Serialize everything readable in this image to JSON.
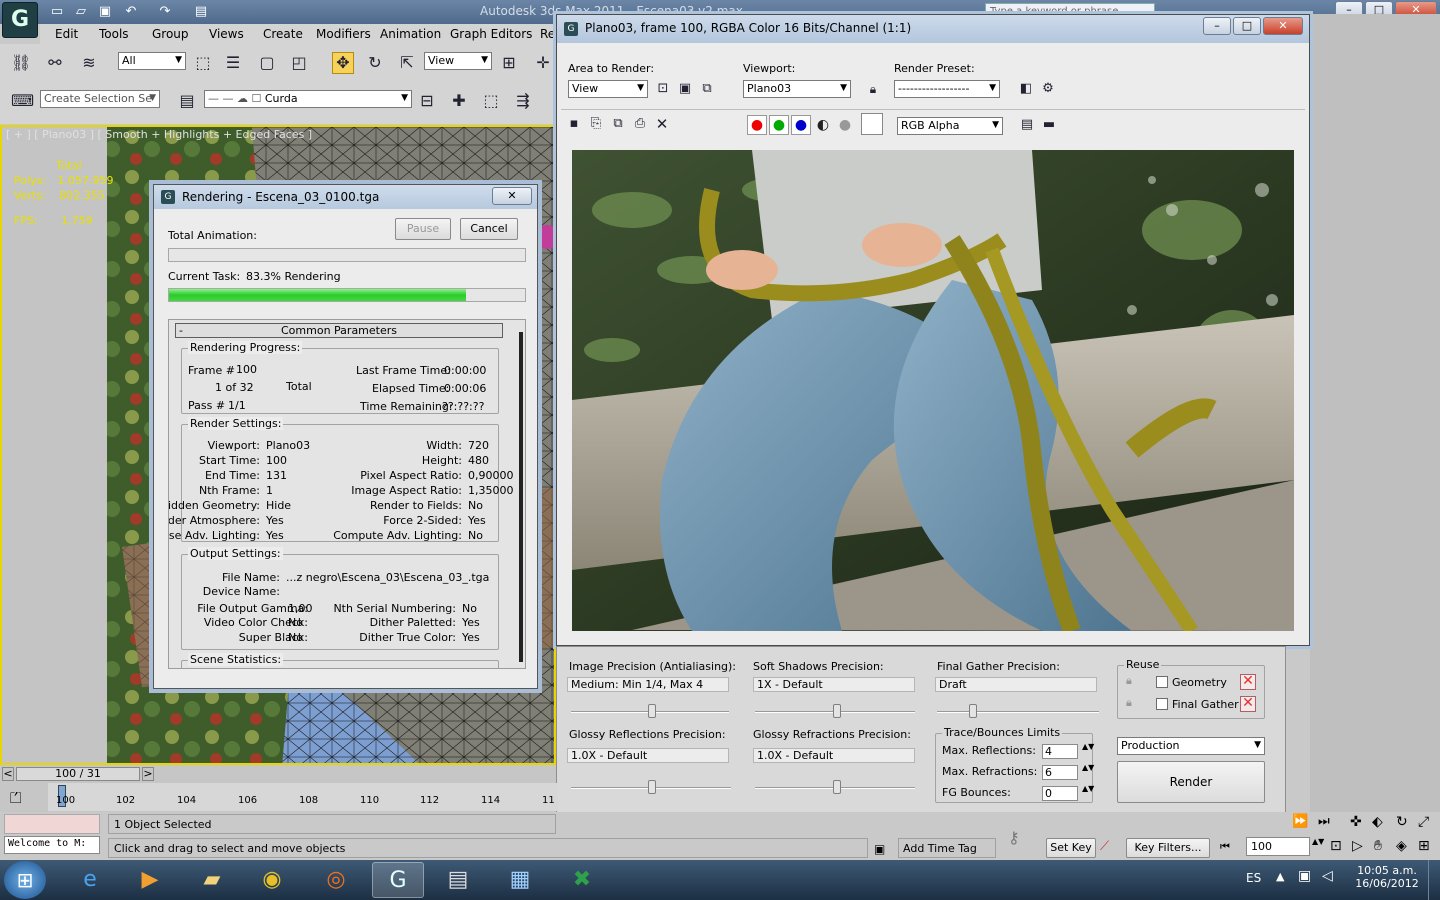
{
  "app": {
    "title": "Autodesk 3ds Max 2011 - Escena03 v2.max",
    "menu": [
      "Edit",
      "Tools",
      "Group",
      "Views",
      "Create",
      "Modifiers",
      "Animation",
      "Graph Editors",
      "Re"
    ],
    "search_placeholder": "Type a keyword or phrase",
    "selection_filter": "All",
    "ref_coord": "View",
    "named_selection": "Create Selection Se",
    "layer": "Curda"
  },
  "viewport": {
    "label": "[ + ] [ Plano03 ] [ Smooth + Highlights + Edged Faces ]",
    "stats_total": "Total",
    "polys_label": "Polys:",
    "polys_value": "1.057.959",
    "verts_label": "Verts:",
    "verts_value": "802.355",
    "fps_label": "FPS:",
    "fps_value": "1,759"
  },
  "rendering_dialog": {
    "title": "Rendering - Escena_03_0100.tga",
    "pause": "Pause",
    "cancel": "Cancel",
    "total_animation_label": "Total Animation:",
    "total_animation_progress": 0.0,
    "current_task_label": "Current Task:",
    "current_task_value": "83.3%  Rendering",
    "current_task_progress": 0.833,
    "rollout_title": "Common Parameters",
    "rollout_toggle": "-",
    "progress_group": "Rendering Progress:",
    "frame_label": "Frame #",
    "frame_value": "100",
    "of_value": "1 of 32",
    "total_label": "Total",
    "pass_label": "Pass #",
    "pass_value": "1/1",
    "last_frame_time_label": "Last Frame Time:",
    "last_frame_time": "0:00:00",
    "elapsed_label": "Elapsed Time:",
    "elapsed": "0:00:06",
    "remaining_label": "Time Remaining:",
    "remaining": "??:??:??",
    "render_settings_group": "Render Settings:",
    "viewport_label": "Viewport:",
    "viewport_value": "Plano03",
    "width_label": "Width:",
    "width_value": "720",
    "start_label": "Start Time:",
    "start_value": "100",
    "height_label": "Height:",
    "height_value": "480",
    "end_label": "End Time:",
    "end_value": "131",
    "pixel_aspect_label": "Pixel Aspect Ratio:",
    "pixel_aspect_value": "0,90000",
    "nth_label": "Nth Frame:",
    "nth_value": "1",
    "image_aspect_label": "Image Aspect Ratio:",
    "image_aspect_value": "1,35000",
    "hidden_geo_label": "Hidden Geometry:",
    "hidden_geo_value": "Hide",
    "render_fields_label": "Render to Fields:",
    "render_fields_value": "No",
    "render_atm_label": "Render Atmosphere:",
    "render_atm_value": "Yes",
    "force2_label": "Force 2-Sided:",
    "force2_value": "Yes",
    "adv_light_label": "Use Adv. Lighting:",
    "adv_light_value": "Yes",
    "compute_adv_label": "Compute Adv. Lighting:",
    "compute_adv_value": "No",
    "output_group": "Output Settings:",
    "file_name_label": "File Name:",
    "file_name_value": "...z negro\\Escena_03\\Escena_03_.tga",
    "device_label": "Device Name:",
    "gamma_label": "File Output Gamma:",
    "gamma_value": "1,00",
    "nth_serial_label": "Nth Serial Numbering:",
    "nth_serial_value": "No",
    "video_label": "Video Color Check:",
    "video_value": "No",
    "dither_pal_label": "Dither Paletted:",
    "dither_pal_value": "Yes",
    "super_black_label": "Super Black:",
    "super_black_value": "No",
    "dither_true_label": "Dither True Color:",
    "dither_true_value": "Yes",
    "scene_stats_group": "Scene Statistics:"
  },
  "frame_window": {
    "title": "Plano03, frame 100, RGBA Color 16 Bits/Channel (1:1)",
    "area_label": "Area to Render:",
    "area_value": "View",
    "viewport_label": "Viewport:",
    "viewport_value": "Plano03",
    "preset_label": "Render Preset:",
    "preset_value": "------------------",
    "channel_value": "RGB Alpha"
  },
  "render_setup": {
    "image_precision_label": "Image Precision (Antialiasing):",
    "image_precision_value": "Medium: Min 1/4, Max 4",
    "soft_shadows_label": "Soft Shadows Precision:",
    "soft_shadows_value": "1X - Default",
    "fg_precision_label": "Final Gather Precision:",
    "fg_precision_value": "Draft",
    "glossy_refl_label": "Glossy Reflections Precision:",
    "glossy_refl_value": "1.0X - Default",
    "glossy_refr_label": "Glossy Refractions Precision:",
    "glossy_refr_value": "1.0X - Default",
    "trace_group": "Trace/Bounces Limits",
    "max_refl_label": "Max. Reflections:",
    "max_refl_value": "4",
    "max_refr_label": "Max. Refractions:",
    "max_refr_value": "6",
    "fg_bounces_label": "FG Bounces:",
    "fg_bounces_value": "0",
    "reuse_group": "Reuse",
    "geometry_label": "Geometry",
    "final_gather_label": "Final Gather",
    "production_value": "Production",
    "render_button": "Render"
  },
  "timeline": {
    "frame_counter": "100 / 31",
    "prev": "<",
    "next": ">",
    "ticks": [
      "100",
      "102",
      "104",
      "106",
      "108",
      "110",
      "112",
      "114",
      "11"
    ]
  },
  "status": {
    "welcome": "Welcome to M:",
    "selected": "1 Object Selected",
    "prompt": "Click and drag to select and move objects",
    "add_time_tag": "Add Time Tag",
    "set_key": "Set Key",
    "key_filters": "Key Filters...",
    "frame_field": "100"
  },
  "taskbar": {
    "language": "ES",
    "time": "10:05 a.m.",
    "date": "16/06/2012"
  }
}
